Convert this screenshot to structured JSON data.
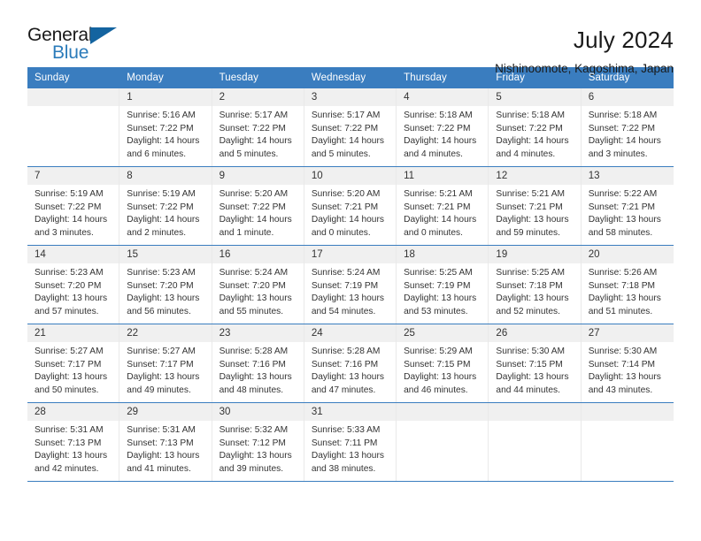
{
  "brand": {
    "name_part1": "General",
    "name_part2": "Blue",
    "flag_color": "#1464a0",
    "blue_color": "#2b7bba"
  },
  "header": {
    "title": "July 2024",
    "subtitle": "Nishinoomote, Kagoshima, Japan",
    "header_bg": "#3a7dbf"
  },
  "weekdays": [
    "Sunday",
    "Monday",
    "Tuesday",
    "Wednesday",
    "Thursday",
    "Friday",
    "Saturday"
  ],
  "weeks": [
    [
      {
        "day": "",
        "sunrise": "",
        "sunset": "",
        "daylight1": "",
        "daylight2": ""
      },
      {
        "day": "1",
        "sunrise": "Sunrise: 5:16 AM",
        "sunset": "Sunset: 7:22 PM",
        "daylight1": "Daylight: 14 hours",
        "daylight2": "and 6 minutes."
      },
      {
        "day": "2",
        "sunrise": "Sunrise: 5:17 AM",
        "sunset": "Sunset: 7:22 PM",
        "daylight1": "Daylight: 14 hours",
        "daylight2": "and 5 minutes."
      },
      {
        "day": "3",
        "sunrise": "Sunrise: 5:17 AM",
        "sunset": "Sunset: 7:22 PM",
        "daylight1": "Daylight: 14 hours",
        "daylight2": "and 5 minutes."
      },
      {
        "day": "4",
        "sunrise": "Sunrise: 5:18 AM",
        "sunset": "Sunset: 7:22 PM",
        "daylight1": "Daylight: 14 hours",
        "daylight2": "and 4 minutes."
      },
      {
        "day": "5",
        "sunrise": "Sunrise: 5:18 AM",
        "sunset": "Sunset: 7:22 PM",
        "daylight1": "Daylight: 14 hours",
        "daylight2": "and 4 minutes."
      },
      {
        "day": "6",
        "sunrise": "Sunrise: 5:18 AM",
        "sunset": "Sunset: 7:22 PM",
        "daylight1": "Daylight: 14 hours",
        "daylight2": "and 3 minutes."
      }
    ],
    [
      {
        "day": "7",
        "sunrise": "Sunrise: 5:19 AM",
        "sunset": "Sunset: 7:22 PM",
        "daylight1": "Daylight: 14 hours",
        "daylight2": "and 3 minutes."
      },
      {
        "day": "8",
        "sunrise": "Sunrise: 5:19 AM",
        "sunset": "Sunset: 7:22 PM",
        "daylight1": "Daylight: 14 hours",
        "daylight2": "and 2 minutes."
      },
      {
        "day": "9",
        "sunrise": "Sunrise: 5:20 AM",
        "sunset": "Sunset: 7:22 PM",
        "daylight1": "Daylight: 14 hours",
        "daylight2": "and 1 minute."
      },
      {
        "day": "10",
        "sunrise": "Sunrise: 5:20 AM",
        "sunset": "Sunset: 7:21 PM",
        "daylight1": "Daylight: 14 hours",
        "daylight2": "and 0 minutes."
      },
      {
        "day": "11",
        "sunrise": "Sunrise: 5:21 AM",
        "sunset": "Sunset: 7:21 PM",
        "daylight1": "Daylight: 14 hours",
        "daylight2": "and 0 minutes."
      },
      {
        "day": "12",
        "sunrise": "Sunrise: 5:21 AM",
        "sunset": "Sunset: 7:21 PM",
        "daylight1": "Daylight: 13 hours",
        "daylight2": "and 59 minutes."
      },
      {
        "day": "13",
        "sunrise": "Sunrise: 5:22 AM",
        "sunset": "Sunset: 7:21 PM",
        "daylight1": "Daylight: 13 hours",
        "daylight2": "and 58 minutes."
      }
    ],
    [
      {
        "day": "14",
        "sunrise": "Sunrise: 5:23 AM",
        "sunset": "Sunset: 7:20 PM",
        "daylight1": "Daylight: 13 hours",
        "daylight2": "and 57 minutes."
      },
      {
        "day": "15",
        "sunrise": "Sunrise: 5:23 AM",
        "sunset": "Sunset: 7:20 PM",
        "daylight1": "Daylight: 13 hours",
        "daylight2": "and 56 minutes."
      },
      {
        "day": "16",
        "sunrise": "Sunrise: 5:24 AM",
        "sunset": "Sunset: 7:20 PM",
        "daylight1": "Daylight: 13 hours",
        "daylight2": "and 55 minutes."
      },
      {
        "day": "17",
        "sunrise": "Sunrise: 5:24 AM",
        "sunset": "Sunset: 7:19 PM",
        "daylight1": "Daylight: 13 hours",
        "daylight2": "and 54 minutes."
      },
      {
        "day": "18",
        "sunrise": "Sunrise: 5:25 AM",
        "sunset": "Sunset: 7:19 PM",
        "daylight1": "Daylight: 13 hours",
        "daylight2": "and 53 minutes."
      },
      {
        "day": "19",
        "sunrise": "Sunrise: 5:25 AM",
        "sunset": "Sunset: 7:18 PM",
        "daylight1": "Daylight: 13 hours",
        "daylight2": "and 52 minutes."
      },
      {
        "day": "20",
        "sunrise": "Sunrise: 5:26 AM",
        "sunset": "Sunset: 7:18 PM",
        "daylight1": "Daylight: 13 hours",
        "daylight2": "and 51 minutes."
      }
    ],
    [
      {
        "day": "21",
        "sunrise": "Sunrise: 5:27 AM",
        "sunset": "Sunset: 7:17 PM",
        "daylight1": "Daylight: 13 hours",
        "daylight2": "and 50 minutes."
      },
      {
        "day": "22",
        "sunrise": "Sunrise: 5:27 AM",
        "sunset": "Sunset: 7:17 PM",
        "daylight1": "Daylight: 13 hours",
        "daylight2": "and 49 minutes."
      },
      {
        "day": "23",
        "sunrise": "Sunrise: 5:28 AM",
        "sunset": "Sunset: 7:16 PM",
        "daylight1": "Daylight: 13 hours",
        "daylight2": "and 48 minutes."
      },
      {
        "day": "24",
        "sunrise": "Sunrise: 5:28 AM",
        "sunset": "Sunset: 7:16 PM",
        "daylight1": "Daylight: 13 hours",
        "daylight2": "and 47 minutes."
      },
      {
        "day": "25",
        "sunrise": "Sunrise: 5:29 AM",
        "sunset": "Sunset: 7:15 PM",
        "daylight1": "Daylight: 13 hours",
        "daylight2": "and 46 minutes."
      },
      {
        "day": "26",
        "sunrise": "Sunrise: 5:30 AM",
        "sunset": "Sunset: 7:15 PM",
        "daylight1": "Daylight: 13 hours",
        "daylight2": "and 44 minutes."
      },
      {
        "day": "27",
        "sunrise": "Sunrise: 5:30 AM",
        "sunset": "Sunset: 7:14 PM",
        "daylight1": "Daylight: 13 hours",
        "daylight2": "and 43 minutes."
      }
    ],
    [
      {
        "day": "28",
        "sunrise": "Sunrise: 5:31 AM",
        "sunset": "Sunset: 7:13 PM",
        "daylight1": "Daylight: 13 hours",
        "daylight2": "and 42 minutes."
      },
      {
        "day": "29",
        "sunrise": "Sunrise: 5:31 AM",
        "sunset": "Sunset: 7:13 PM",
        "daylight1": "Daylight: 13 hours",
        "daylight2": "and 41 minutes."
      },
      {
        "day": "30",
        "sunrise": "Sunrise: 5:32 AM",
        "sunset": "Sunset: 7:12 PM",
        "daylight1": "Daylight: 13 hours",
        "daylight2": "and 39 minutes."
      },
      {
        "day": "31",
        "sunrise": "Sunrise: 5:33 AM",
        "sunset": "Sunset: 7:11 PM",
        "daylight1": "Daylight: 13 hours",
        "daylight2": "and 38 minutes."
      },
      {
        "day": "",
        "sunrise": "",
        "sunset": "",
        "daylight1": "",
        "daylight2": ""
      },
      {
        "day": "",
        "sunrise": "",
        "sunset": "",
        "daylight1": "",
        "daylight2": ""
      },
      {
        "day": "",
        "sunrise": "",
        "sunset": "",
        "daylight1": "",
        "daylight2": ""
      }
    ]
  ]
}
